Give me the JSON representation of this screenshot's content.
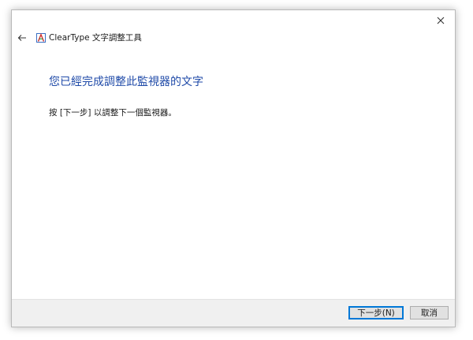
{
  "window": {
    "title": "ClearType 文字調整工具"
  },
  "icons": {
    "back": "arrow-left-icon",
    "close": "close-x-icon",
    "app": "cleartype-icon"
  },
  "content": {
    "heading": "您已經完成調整此監視器的文字",
    "instruction": "按 [下一步] 以調整下一個監視器。"
  },
  "footer": {
    "next_label": "下一步(N)",
    "cancel_label": "取消"
  },
  "colors": {
    "heading": "#1f4aa8",
    "accent": "#0078d7",
    "footer_bg": "#f0f0f0"
  }
}
